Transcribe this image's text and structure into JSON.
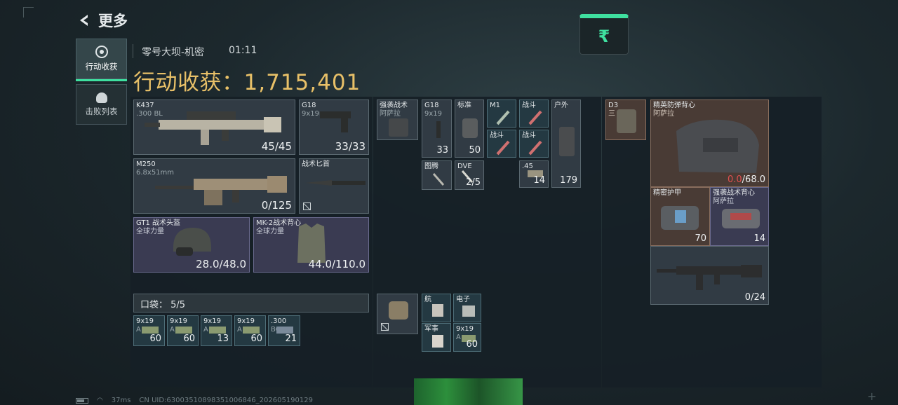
{
  "header": {
    "back_label": "更多",
    "currency_symbol": "₹"
  },
  "side_tabs": [
    {
      "label": "行动收获",
      "active": true
    },
    {
      "label": "击败列表",
      "active": false
    }
  ],
  "match": {
    "map_name": "零号大坝-机密",
    "time": "01:11"
  },
  "haul": {
    "label": "行动收获：",
    "value": "1,715,401"
  },
  "gear": {
    "primary": {
      "name": "K437",
      "sub": ".300 BL",
      "stat": "45/45"
    },
    "sidearm": {
      "name": "G18",
      "sub": "9x19mm",
      "stat": "33/33"
    },
    "secondary": {
      "name": "M250",
      "sub": "6.8x51mm",
      "stat": "0/125"
    },
    "melee": {
      "name": "战术匕首"
    },
    "helmet": {
      "name": "GT1 战术头盔",
      "sub": "全球力量",
      "stat": "28.0/48.0"
    },
    "armor": {
      "name": "MK-2战术背心",
      "sub": "全球力量",
      "stat": "44.0/110.0"
    }
  },
  "pocket": {
    "label": "口袋：",
    "count": "5/5",
    "items": [
      {
        "name": "9x19",
        "sub": "A",
        "stat": "60"
      },
      {
        "name": "9x19",
        "sub": "A",
        "stat": "60"
      },
      {
        "name": "9x19",
        "sub": "A",
        "stat": "13"
      },
      {
        "name": "9x19",
        "sub": "A",
        "stat": "60"
      },
      {
        "name": ".300",
        "sub": "BC",
        "stat": "21"
      }
    ]
  },
  "rig": {
    "name": "强袭战术",
    "sub": "阿萨拉",
    "items": [
      {
        "name": "G18",
        "sub": "9x19",
        "stat": "33"
      },
      {
        "name": "标准",
        "sub": "",
        "stat": "50"
      },
      {
        "name": "M1"
      },
      {
        "name": "战斗"
      },
      {
        "name": "户外",
        "stat": "179"
      },
      {
        "name": "战斗"
      },
      {
        "name": "战斗"
      },
      {
        "name": "图腾"
      },
      {
        "name": "DVE",
        "stat": "2/5"
      },
      {
        "name": ".45",
        "stat": "14"
      }
    ]
  },
  "backpack_slot": {
    "items": [
      {
        "name": "航"
      },
      {
        "name": "电子"
      },
      {
        "name": "军事"
      },
      {
        "name": "9x19",
        "sub": "A",
        "stat": "60"
      }
    ]
  },
  "loot": {
    "items": [
      {
        "name": "D3",
        "sub": "三"
      },
      {
        "name": "精英防弹背心",
        "sub": "阿萨拉",
        "stat_damaged": "0.0",
        "stat_max": "/68.0"
      },
      {
        "name": "精密护甲",
        "stat": "70"
      },
      {
        "name": "强袭战术背心",
        "sub": "阿萨拉",
        "stat": "14"
      },
      {
        "name": "",
        "stat": "0/24"
      }
    ]
  },
  "status_bar": {
    "ping": "37ms",
    "uid": "CN UID:6300351089835100684​6_202605190129"
  }
}
